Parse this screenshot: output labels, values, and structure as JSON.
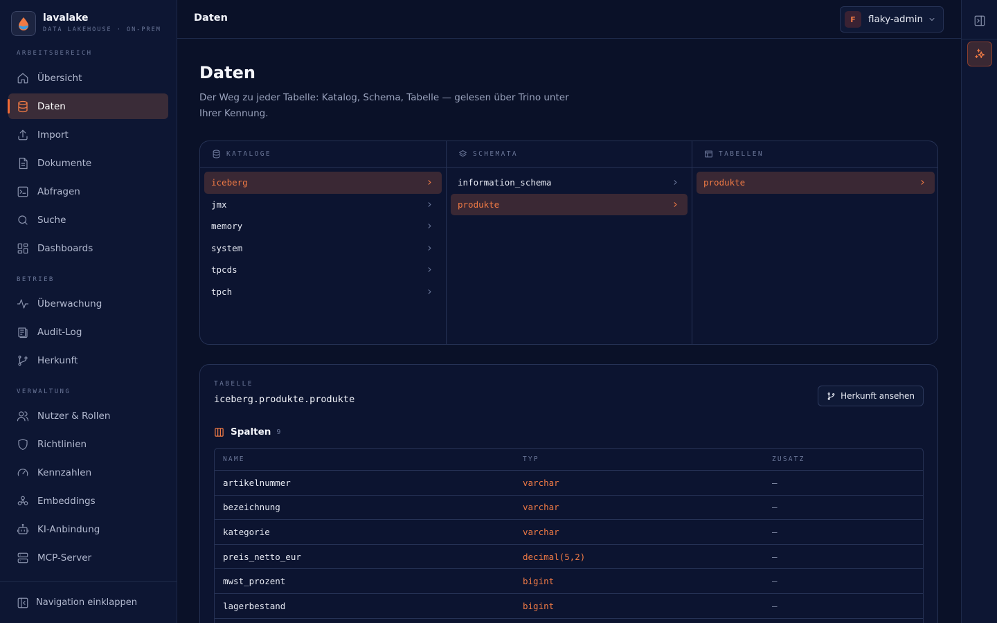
{
  "brand": {
    "name": "lavalake",
    "tagline": "DATA LAKEHOUSE · ON-PREM"
  },
  "sidebar": {
    "sections": [
      {
        "label": "ARBEITSBEREICH"
      },
      {
        "label": "BETRIEB"
      },
      {
        "label": "VERWALTUNG"
      }
    ],
    "items": [
      {
        "label": "Übersicht",
        "icon": "home-icon"
      },
      {
        "label": "Daten",
        "icon": "database-icon",
        "active": true
      },
      {
        "label": "Import",
        "icon": "upload-icon"
      },
      {
        "label": "Dokumente",
        "icon": "document-icon"
      },
      {
        "label": "Abfragen",
        "icon": "terminal-icon"
      },
      {
        "label": "Suche",
        "icon": "search-icon"
      },
      {
        "label": "Dashboards",
        "icon": "dashboard-icon"
      },
      {
        "label": "Überwachung",
        "icon": "activity-icon"
      },
      {
        "label": "Audit-Log",
        "icon": "audit-log-icon"
      },
      {
        "label": "Herkunft",
        "icon": "git-branch-icon"
      },
      {
        "label": "Nutzer & Rollen",
        "icon": "users-icon"
      },
      {
        "label": "Richtlinien",
        "icon": "shield-icon"
      },
      {
        "label": "Kennzahlen",
        "icon": "gauge-icon"
      },
      {
        "label": "Embeddings",
        "icon": "embeddings-icon"
      },
      {
        "label": "KI-Anbindung",
        "icon": "bot-icon"
      },
      {
        "label": "MCP-Server",
        "icon": "server-icon"
      }
    ],
    "collapse_label": "Navigation einklappen"
  },
  "topbar": {
    "title": "Daten",
    "user": {
      "initial": "F",
      "name": "flaky-admin"
    }
  },
  "page": {
    "title": "Daten",
    "description": "Der Weg zu jeder Tabelle: Katalog, Schema, Tabelle — gelesen über Trino unter Ihrer Kennung."
  },
  "browser": {
    "catalogs": {
      "header": "KATALOGE",
      "items": [
        "iceberg",
        "jmx",
        "memory",
        "system",
        "tpcds",
        "tpch"
      ],
      "selected": "iceberg"
    },
    "schemas": {
      "header": "SCHEMATA",
      "items": [
        "information_schema",
        "produkte"
      ],
      "selected": "produkte"
    },
    "tables": {
      "header": "TABELLEN",
      "items": [
        "produkte"
      ],
      "selected": "produkte"
    }
  },
  "detail": {
    "label": "TABELLE",
    "full_name": "iceberg.produkte.produkte",
    "lineage_button": "Herkunft ansehen",
    "columns_title": "Spalten",
    "columns_count": "9",
    "headers": [
      "NAME",
      "TYP",
      "ZUSATZ"
    ],
    "rows": [
      {
        "name": "artikelnummer",
        "type": "varchar",
        "extra": "—"
      },
      {
        "name": "bezeichnung",
        "type": "varchar",
        "extra": "—"
      },
      {
        "name": "kategorie",
        "type": "varchar",
        "extra": "—"
      },
      {
        "name": "preis_netto_eur",
        "type": "decimal(5,2)",
        "extra": "—"
      },
      {
        "name": "mwst_prozent",
        "type": "bigint",
        "extra": "—"
      },
      {
        "name": "lagerbestand",
        "type": "bigint",
        "extra": "—"
      }
    ]
  },
  "colors": {
    "accent": "#f07a45",
    "background": "#0a1128",
    "sidebar": "#0d1633",
    "border": "#263255"
  }
}
